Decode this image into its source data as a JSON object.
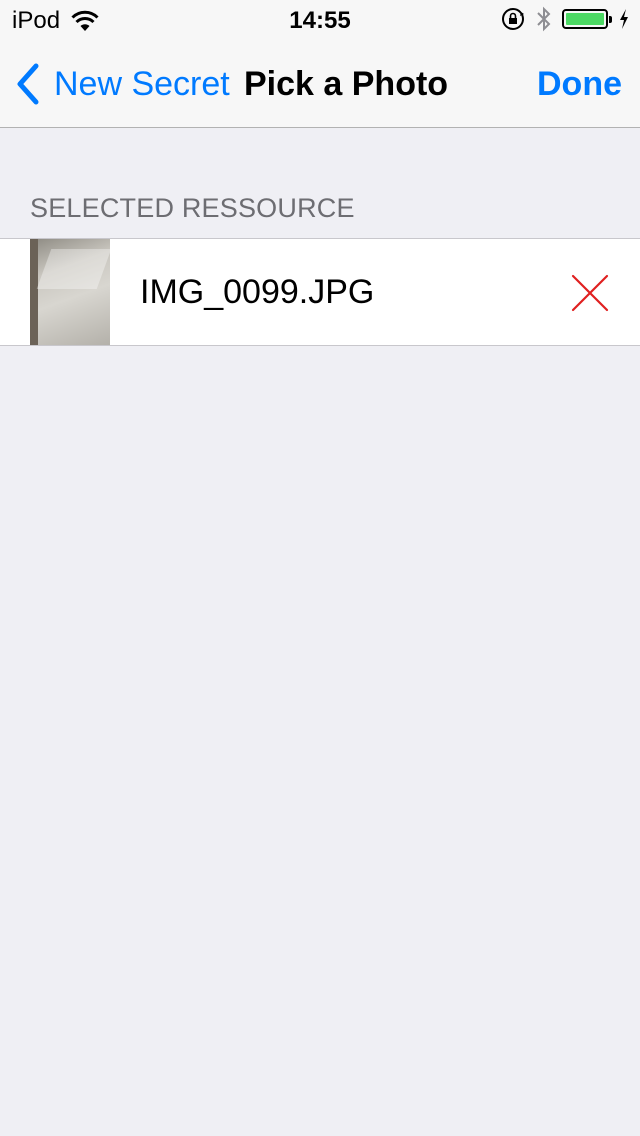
{
  "status_bar": {
    "device": "iPod",
    "time": "14:55",
    "battery_color": "#4cd964"
  },
  "nav": {
    "back_label": "New Secret",
    "title": "Pick a Photo",
    "done_label": "Done",
    "accent_color": "#007aff"
  },
  "section": {
    "header": "SELECTED RESSOURCE"
  },
  "resources": [
    {
      "filename": "IMG_0099.JPG",
      "icon": "remove-x-icon",
      "remove_color": "#e02020"
    }
  ]
}
